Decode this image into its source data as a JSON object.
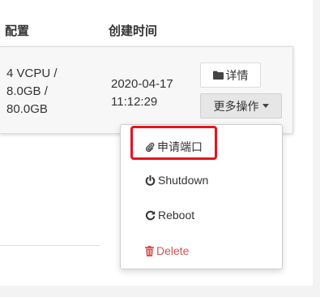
{
  "table": {
    "headers": {
      "config": "配置",
      "created": "创建时间"
    },
    "row": {
      "config_lines": [
        "4 VCPU /",
        "8.0GB /",
        "80.0GB"
      ],
      "created_lines": [
        "2020-04-17",
        "11:12:29"
      ],
      "detail_button": {
        "label": "详情",
        "icon": "folder-icon"
      },
      "more_button": {
        "label": "更多操作",
        "icon": "caret-down-icon"
      }
    }
  },
  "dropdown": {
    "items": [
      {
        "label": "申请端口",
        "icon": "paperclip-icon",
        "highlighted": true
      },
      {
        "label": "Shutdown",
        "icon": "power-icon"
      },
      {
        "label": "Reboot",
        "icon": "refresh-icon"
      },
      {
        "label": "Delete",
        "icon": "trash-icon"
      }
    ]
  },
  "colors": {
    "highlight_border": "#e8131b",
    "delete_text": "#d9534f",
    "more_button_bg": "#e6e6e6",
    "row_bg": "#f7f7f7"
  }
}
